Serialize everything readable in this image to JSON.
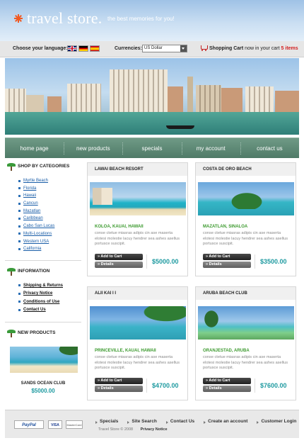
{
  "header": {
    "logo": "travel store.",
    "tagline": "the best memories for you!"
  },
  "utility": {
    "language_label": "Choose your language:",
    "flags": [
      "english-flag-icon",
      "german-flag-icon",
      "spanish-flag-icon"
    ],
    "currency_label": "Currencies:",
    "currency_value": "US Dollar",
    "cart_label": "Shopping Cart",
    "cart_text": "now in your cart",
    "cart_items": "5 items"
  },
  "nav": [
    "home page",
    "new products",
    "specials",
    "my account",
    "contact us"
  ],
  "sidebar": {
    "categories_heading": "SHOP BY CATEGORIES",
    "categories": [
      "Myrtle Beach",
      "Florida",
      "Hawaii",
      "Cancun",
      "Mazatlan",
      "Caribbean",
      "Cabo San Lucas",
      "Multi-Locations",
      "Western USA",
      "California"
    ],
    "information_heading": "INFORMATION",
    "information": [
      "Shipping & Returns",
      "Privacy Notice",
      "Conditions of Use",
      "Contact Us"
    ],
    "new_products_heading": "NEW PRODUCTS",
    "new_product": {
      "title": "SANDS OCEAN CLUB",
      "price": "$5000.00"
    }
  },
  "products": [
    {
      "title": "LAWAI BEACH RESORT",
      "location": "KOLOA, KAUAI, HAWAII",
      "desc": "conse ctetue miasras adipis cin ase maserta elotesi molestie lacuy hendrer sea ashes asellus portusce suscipit.",
      "price": "$5000.00",
      "add_label": "Add to Cart",
      "details_label": "Details"
    },
    {
      "title": "COSTA DE ORO BEACH",
      "location": "MAZATLAN, SINALOA",
      "desc": "conse ctetue miasras adipis cin ase maserta elotesi molestie lacuy hendrer sea ashes asellus portusce suscipit.",
      "price": "$3500.00",
      "add_label": "Add to Cart",
      "details_label": "Details"
    },
    {
      "title": "ALII KAI I I",
      "location": "PRINCEVILLE, KAUAI, HAWAII",
      "desc": "conse ctetue miasras adipis cin ase maserta elotesi molestie lacuy hendrer sea ashes asellus portusce suscipit.",
      "price": "$4700.00",
      "add_label": "Add to Cart",
      "details_label": "Details"
    },
    {
      "title": "ARUBA BEACH CLUB",
      "location": "ORANJESTAD, ARUBA",
      "desc": "conse ctetue miasras adipis cin ase maserta elotesi molestie lacuy hendrer sea ashes asellus portusce suscipit.",
      "price": "$7600.00",
      "add_label": "Add to Cart",
      "details_label": "Details"
    }
  ],
  "footer": {
    "payments": [
      "PayPal",
      "VISA",
      "MasterCard"
    ],
    "links": [
      "Specials",
      "Site Search",
      "Contact Us",
      "Create an account",
      "Customer Login"
    ],
    "copyright": "Travel Store © 2008",
    "privacy": "Privacy Notice"
  },
  "colors": {
    "accent": "#1e9aa0",
    "nav_bg": "#5f8a76",
    "location_green": "#3c9a2e",
    "cart_red": "#d21f1f"
  }
}
